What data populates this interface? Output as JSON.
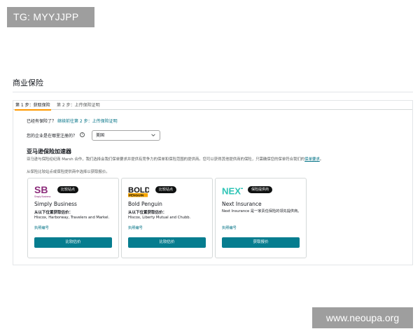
{
  "watermarks": {
    "top_left": "TG: MYYJJPP",
    "bottom_right": "www.neoupa.org"
  },
  "page": {
    "title": "商业保险"
  },
  "tabs": [
    {
      "label": "第 1 步：获取保险",
      "active": true
    },
    {
      "label": "第 2 步：上传保险证明",
      "active": false
    }
  ],
  "registered": {
    "question": "已经有保险了？",
    "link": "继续前往第 2 步：上传保险证明"
  },
  "country": {
    "label": "您的企业是在哪里注册的？",
    "info_icon": "info-icon",
    "selected": "美国",
    "chevron_icon": "chevron-down-icon"
  },
  "accelerator": {
    "heading": "亚马逊保险加速器",
    "description": "亚马逊与保险经纪商 Marsh 合作，我们选择会我们保单要求并提供有竞争力的保单和保险范围的提供商。您可以获得其他提供商的保险，只需确保您的保单符合我们的",
    "description_link": "保单要求",
    "description_end": "。",
    "instruction": "从保险比较站点或保险提供商中选择以获取报价。"
  },
  "cards": [
    {
      "logo_text": "SB",
      "logo_sub": "Simply Business",
      "badge": "比较站点",
      "name": "Simply Business",
      "subtitle": "从以下位置获取估价：",
      "text": "Hiscox, Harborway, Travelers and Markel.",
      "link": "执照编号",
      "button": "比较估价"
    },
    {
      "logo_text": "BOLD",
      "logo_sub": "PENGUIN",
      "badge": "比较站点",
      "name": "Bold Penguin",
      "subtitle": "从以下位置获取估价：",
      "text": "Hiscox, Liberty Mutual and Chubb.",
      "link": "执照编号",
      "button": "比较估价"
    },
    {
      "logo_text": "NEXT",
      "logo_sub": "",
      "badge": "保险提供商",
      "name": "Next Insurance",
      "subtitle": "",
      "text": "Next Insurance 是一家责任保险的领先提供商。",
      "link": "执照编号",
      "button": "获取报价"
    }
  ],
  "colors": {
    "accent": "#067d8f",
    "link": "#007185",
    "tab_active": "#ff9900",
    "sb_logo": "#8b2a7a",
    "bold_penguin_logo": "#f7a600",
    "next_logo": "#2ec4b6"
  }
}
